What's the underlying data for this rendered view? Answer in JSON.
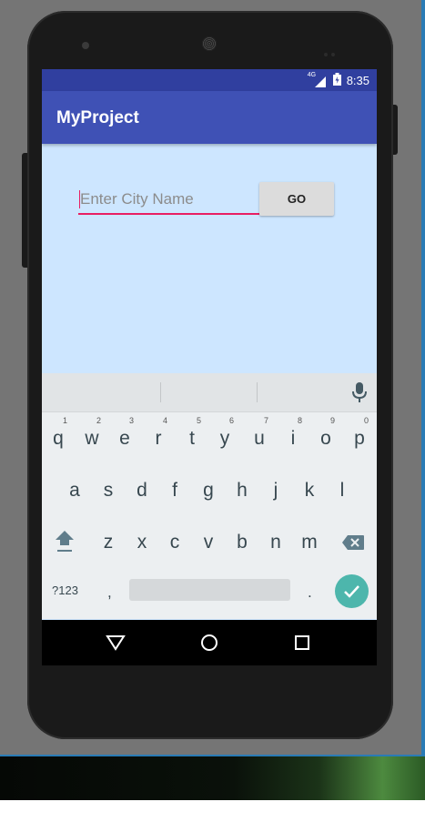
{
  "status_bar": {
    "signal": "4G",
    "time": "8:35"
  },
  "app_bar": {
    "title": "MyProject"
  },
  "form": {
    "city_placeholder": "Enter City Name",
    "go_label": "GO"
  },
  "keyboard": {
    "row1": [
      "q",
      "w",
      "e",
      "r",
      "t",
      "y",
      "u",
      "i",
      "o",
      "p"
    ],
    "row1_numbers": [
      "1",
      "2",
      "3",
      "4",
      "5",
      "6",
      "7",
      "8",
      "9",
      "0"
    ],
    "row2": [
      "a",
      "s",
      "d",
      "f",
      "g",
      "h",
      "j",
      "k",
      "l"
    ],
    "row3": [
      "z",
      "x",
      "c",
      "v",
      "b",
      "n",
      "m"
    ],
    "symbols_label": "?123",
    "comma": ",",
    "period": "."
  },
  "icons": {
    "mic": "microphone-icon",
    "shift": "shift-icon",
    "backspace": "backspace-icon",
    "enter": "checkmark-icon",
    "back": "back-triangle-icon",
    "home": "home-circle-icon",
    "recents": "recents-square-icon"
  },
  "colors": {
    "status_bar": "#303f9f",
    "app_bar": "#3f51b5",
    "screen_bg": "#cde6ff",
    "input_underline": "#e91e63",
    "enter_key": "#4db6ac"
  }
}
